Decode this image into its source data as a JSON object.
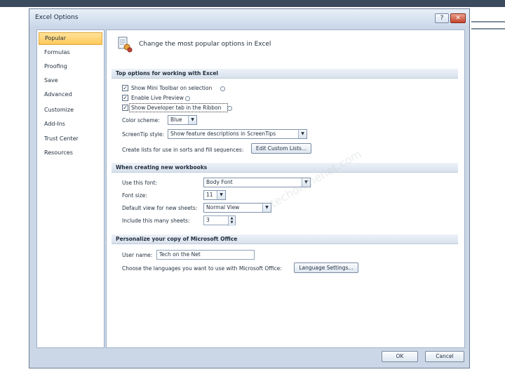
{
  "window": {
    "title": "Excel Options",
    "help_label": "?",
    "close_label": "✕"
  },
  "nav": {
    "items": [
      {
        "label": "Popular",
        "selected": true
      },
      {
        "label": "Formulas"
      },
      {
        "label": "Proofing"
      },
      {
        "label": "Save"
      },
      {
        "label": "Advanced"
      },
      {
        "label": "Customize"
      },
      {
        "label": "Add-Ins"
      },
      {
        "label": "Trust Center"
      },
      {
        "label": "Resources"
      }
    ]
  },
  "header": {
    "text": "Change the most popular options in Excel"
  },
  "top_options": {
    "section_title": "Top options for working with Excel",
    "mini_toolbar": {
      "label": "Show Mini Toolbar on selection",
      "checked": true
    },
    "live_preview": {
      "label": "Enable Live Preview",
      "checked": true
    },
    "developer_tab": {
      "label": "Show Developer tab in the Ribbon",
      "checked": true
    },
    "color_scheme": {
      "label": "Color scheme:",
      "value": "Blue"
    },
    "screentip": {
      "label": "ScreenTip style:",
      "value": "Show feature descriptions in ScreenTips"
    },
    "custom_lists": {
      "label": "Create lists for use in sorts and fill sequences:",
      "button": "Edit Custom Lists..."
    }
  },
  "new_workbooks": {
    "section_title": "When creating new workbooks",
    "font": {
      "label": "Use this font:",
      "value": "Body Font"
    },
    "font_size": {
      "label": "Font size:",
      "value": "11"
    },
    "default_view": {
      "label": "Default view for new sheets:",
      "value": "Normal View"
    },
    "sheets": {
      "label": "Include this many sheets:",
      "value": "3"
    }
  },
  "personalize": {
    "section_title": "Personalize your copy of Microsoft Office",
    "user_name": {
      "label": "User name:",
      "value": "Tech on the Net"
    },
    "languages": {
      "label": "Choose the languages you want to use with Microsoft Office:",
      "button": "Language Settings..."
    }
  },
  "footer": {
    "ok": "OK",
    "cancel": "Cancel"
  },
  "watermark": "techonthenet.com",
  "icons": {
    "check": "✓",
    "dropdown": "▼",
    "spin_up": "▲",
    "spin_down": "▼"
  }
}
